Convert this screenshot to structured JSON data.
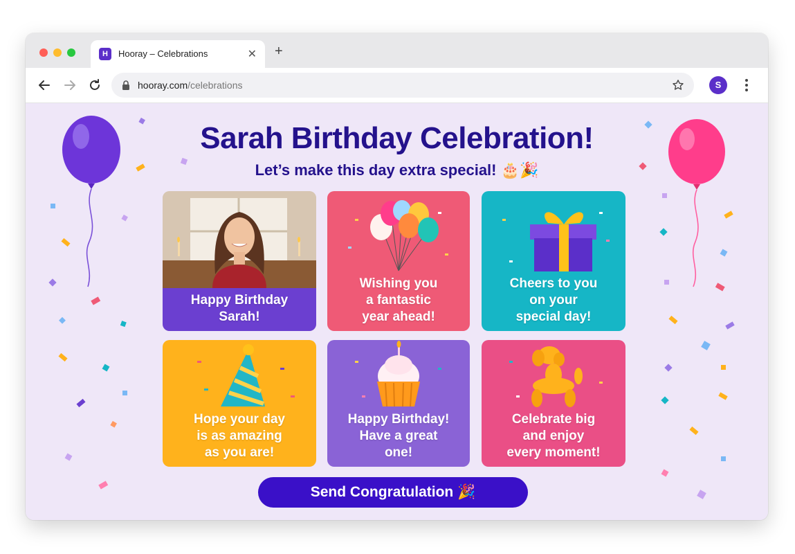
{
  "browser": {
    "tab_title": "Hooray – Celebrations",
    "favicon_letter": "H",
    "url_domain": "hooray.com",
    "url_path": "/celebrations",
    "profile_initial": "S"
  },
  "page": {
    "title": "Sarah Birthday Celebration!",
    "subtitle": "Let’s make this day extra special! 🎂🎉",
    "button_label": "Send Congratulation 🎉"
  },
  "cards": [
    {
      "lines": [
        "Happy Birthday",
        "Sarah!"
      ],
      "color": "#6b3fd0",
      "image": "portrait-photo"
    },
    {
      "lines": [
        "Wishing you",
        "a fantastic",
        "year ahead!"
      ],
      "color": "#ef5a76",
      "image": "balloon-bunch-icon"
    },
    {
      "lines": [
        "Cheers to you",
        "on your",
        "special day!"
      ],
      "color": "#16b6c6",
      "image": "gift-box-icon"
    },
    {
      "lines": [
        "Hope your day",
        "is as amazing",
        "as you are!"
      ],
      "color": "#ffb21c",
      "image": "party-hat-icon"
    },
    {
      "lines": [
        "Happy Birthday!",
        "Have a great",
        "one!"
      ],
      "color": "#8a63d6",
      "image": "cupcake-icon"
    },
    {
      "lines": [
        "Celebrate big",
        "and enjoy",
        "every moment!"
      ],
      "color": "#ea4f86",
      "image": "balloon-dog-icon"
    }
  ],
  "colors": {
    "accent": "#3a10c8",
    "title": "#24128c",
    "page_bg": "#efe7f8",
    "balloon_left": "#6d35d9",
    "balloon_right": "#ff3d8b"
  }
}
